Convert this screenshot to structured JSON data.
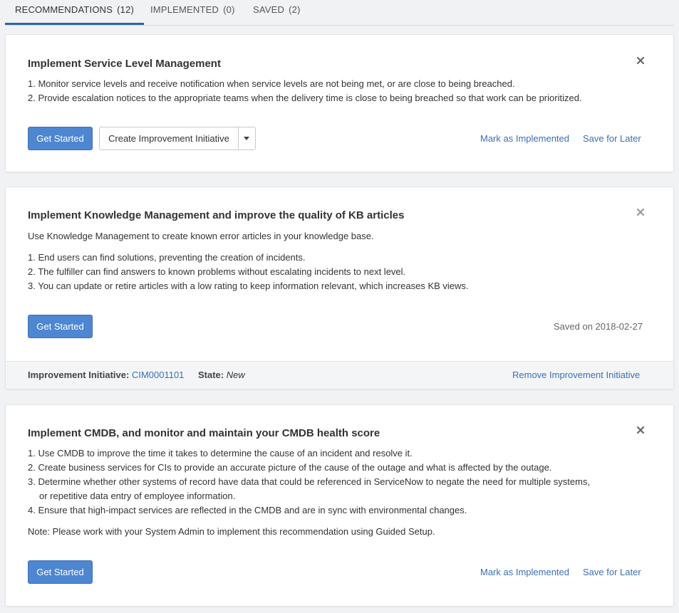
{
  "tabs": [
    {
      "label": "RECOMMENDATIONS",
      "count": "(12)",
      "active": true
    },
    {
      "label": "IMPLEMENTED",
      "count": "(0)",
      "active": false
    },
    {
      "label": "SAVED",
      "count": "(2)",
      "active": false
    }
  ],
  "cards": [
    {
      "title": "Implement Service Level Management",
      "lines": [
        "1. Monitor service levels and receive notification when service levels are not being met, or are close to being breached.",
        "2. Provide escalation notices to the appropriate teams when the delivery time is close to being breached so that work can be prioritized."
      ],
      "primary_button": "Get Started",
      "secondary_button": "Create Improvement Initiative",
      "mark_implemented": "Mark as Implemented",
      "save_later": "Save for Later"
    },
    {
      "title": "Implement Knowledge Management and improve the quality of KB articles",
      "intro": "Use Knowledge Management to create known error articles in your knowledge base.",
      "lines": [
        "1. End users can find solutions, preventing the creation of incidents.",
        "2. The fulfiller can find answers to known problems without escalating incidents to next level.",
        "3. You can update or retire articles with a low rating to keep information relevant, which increases KB views."
      ],
      "primary_button": "Get Started",
      "saved_on": "Saved on 2018-02-27",
      "footer": {
        "initiative_label": "Improvement Initiative:",
        "initiative_value": "CIM0001101",
        "state_label": "State:",
        "state_value": "New",
        "remove_link": "Remove Improvement Initiative"
      }
    },
    {
      "title": "Implement CMDB, and monitor and maintain your CMDB health score",
      "lines": [
        "1. Use CMDB to improve the time it takes to determine the cause of an incident and resolve it.",
        "2. Create business services for CIs to provide an accurate picture of the cause of the outage and what is affected by the outage.",
        "3. Determine whether other systems of record have data that could be referenced in ServiceNow to negate the need for multiple systems,",
        "    or repetitive data entry of employee information.",
        "4. Ensure that high-impact services are reflected in the CMDB and are in sync with environmental changes."
      ],
      "note": "Note: Please work with your System Admin to implement this recommendation using Guided Setup.",
      "primary_button": "Get Started",
      "mark_implemented": "Mark as Implemented",
      "save_later": "Save for Later"
    }
  ],
  "icons": {
    "close": "close-icon",
    "caret": "caret-down-icon"
  },
  "colors": {
    "accent": "#4d86d1",
    "link": "#3a6fb8",
    "tab_underline": "#2a64ac"
  }
}
